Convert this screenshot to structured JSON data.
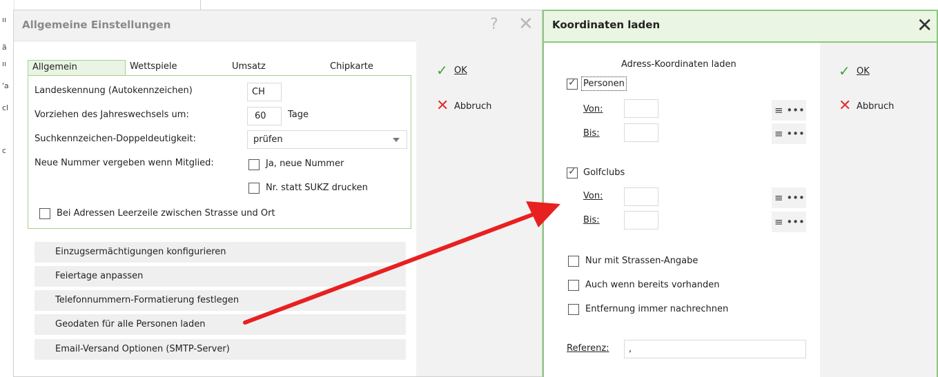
{
  "background": {
    "fragments": [
      "ıı",
      "ä",
      "ıı",
      "'a",
      "cl",
      "c"
    ]
  },
  "dialog_general": {
    "title": "Allgemeine Einstellungen",
    "tabs": [
      "Allgemein",
      "Wettspiele",
      "Umsatz",
      "Chipkarte"
    ],
    "fields": {
      "country_label": "Landeskennung (Autokennzeichen)",
      "country_value": "CH",
      "year_label": "Vorziehen des Jahreswechsels um:",
      "year_value": "60",
      "year_unit": "Tage",
      "search_label": "Suchkennzeichen-Doppeldeutigkeit:",
      "search_value": "prüfen",
      "newnum_label": "Neue Nummer vergeben wenn Mitglied:",
      "newnum_option": "Ja, neue Nummer",
      "print_option": "Nr. statt SUKZ drucken",
      "blankline_option": "Bei Adressen Leerzeile zwischen Strasse und Ort"
    },
    "actions": [
      "Einzugsermächtigungen konfigurieren",
      "Feiertage anpassen",
      "Telefonnummern-Formatierung festlegen",
      "Geodaten für alle Personen laden",
      "Email-Versand Optionen (SMTP-Server)"
    ],
    "ok_label": "OK",
    "cancel_label": "Abbruch"
  },
  "dialog_coords": {
    "title": "Koordinaten laden",
    "section_title": "Adress-Koordinaten laden",
    "persons_label": "Personen",
    "golfclubs_label": "Golfclubs",
    "from_label": "Von:",
    "to_label": "Bis:",
    "only_street": "Nur mit Strassen-Angabe",
    "even_existing": "Auch wenn bereits vorhanden",
    "recalc_distance": "Entfernung immer nachrechnen",
    "reference_label": "Referenz:",
    "reference_value": ",",
    "ok_label": "OK",
    "cancel_label": "Abbruch"
  },
  "colors": {
    "accent_green": "#8bc77a",
    "arrow_red": "#e82020"
  }
}
